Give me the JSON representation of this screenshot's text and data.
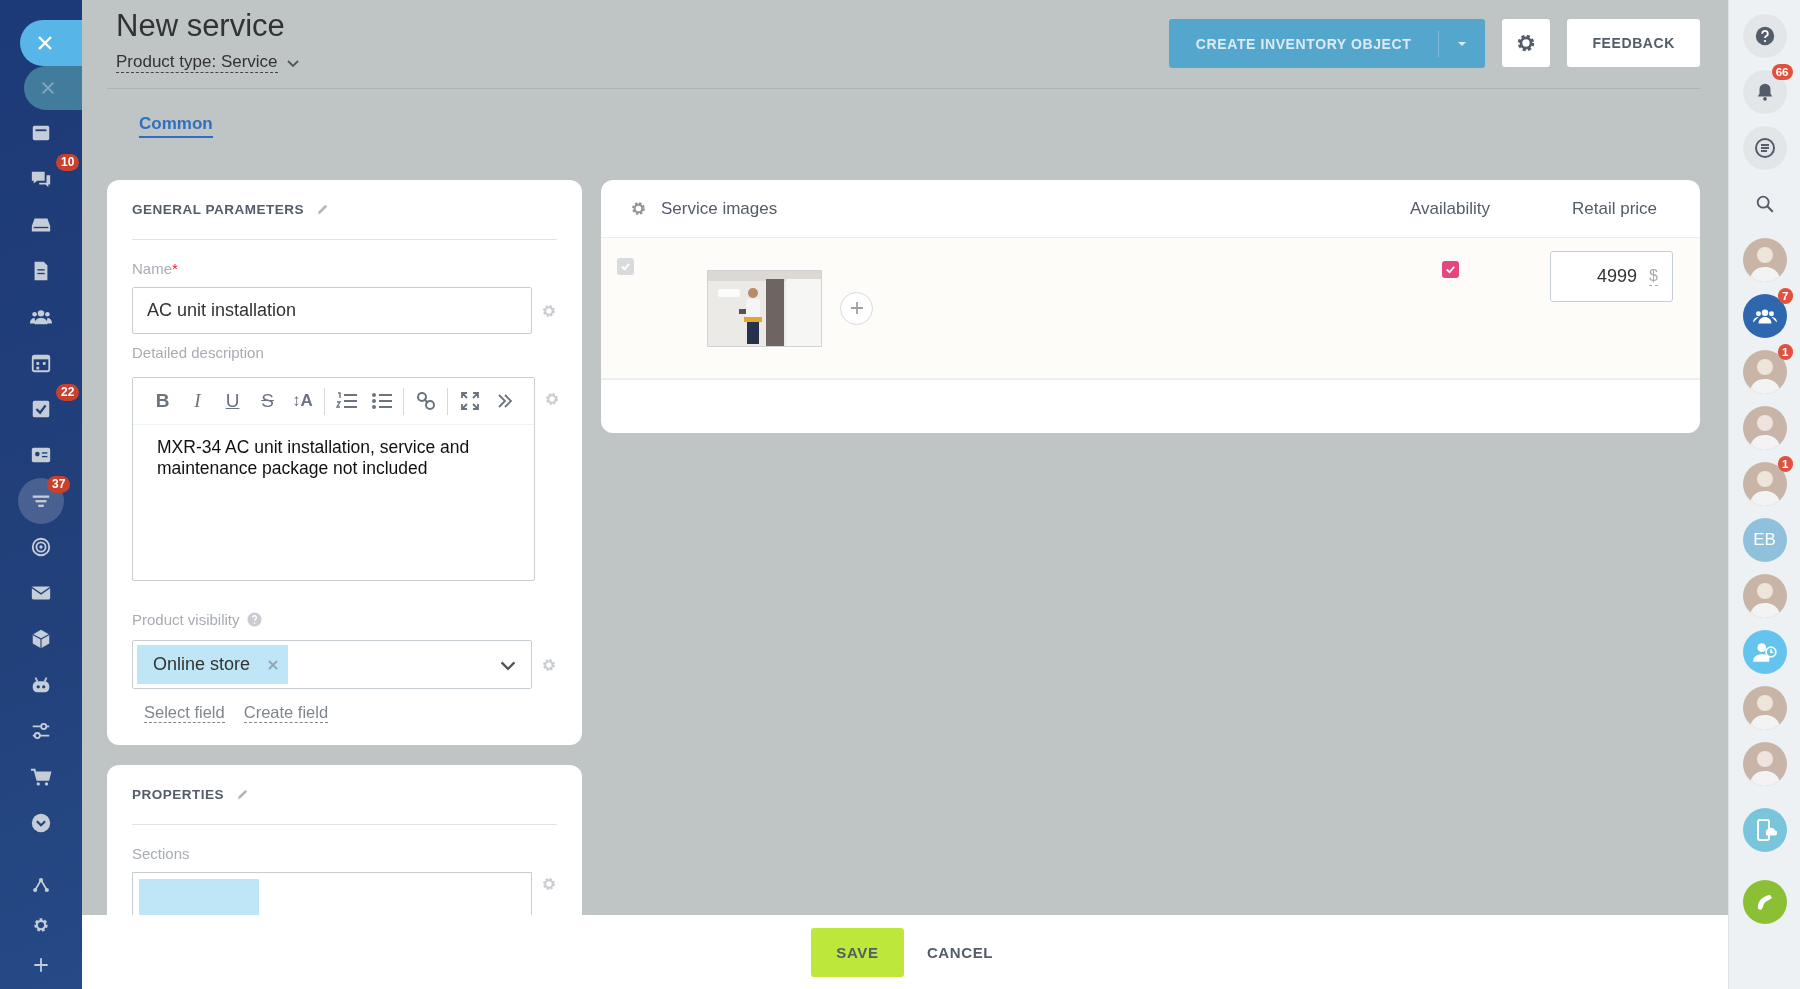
{
  "left_sidebar": {
    "items": [
      {
        "kind": "window",
        "selected": false
      },
      {
        "kind": "chat",
        "badge": "10",
        "selected": false
      },
      {
        "kind": "drive",
        "selected": false
      },
      {
        "kind": "document",
        "selected": false
      },
      {
        "kind": "group",
        "selected": false
      },
      {
        "kind": "calendar",
        "selected": false
      },
      {
        "kind": "task",
        "badge": "22",
        "selected": false
      },
      {
        "kind": "contact",
        "selected": false
      },
      {
        "kind": "filter",
        "badge": "37",
        "selected": true
      },
      {
        "kind": "target",
        "selected": false
      },
      {
        "kind": "mail",
        "selected": false
      },
      {
        "kind": "box",
        "selected": false
      },
      {
        "kind": "robot",
        "selected": false
      },
      {
        "kind": "sliders",
        "selected": false
      },
      {
        "kind": "cart",
        "selected": false
      },
      {
        "kind": "more",
        "selected": false
      }
    ],
    "bottom": [
      {
        "kind": "nodes"
      },
      {
        "kind": "gear"
      },
      {
        "kind": "plus"
      }
    ]
  },
  "header": {
    "title": "New service",
    "product_type": "Product type: Service",
    "create_button": "CREATE INVENTORY OBJECT",
    "feedback_button": "FEEDBACK"
  },
  "tabs": [
    {
      "label": "Common",
      "selected": true
    }
  ],
  "general_parameters": {
    "title": "GENERAL PARAMETERS",
    "name_label": "Name",
    "required_mark": "*",
    "name_value": "AC unit installation",
    "description_label": "Detailed description",
    "toolbar": [
      {
        "kind": "bold",
        "label": "B"
      },
      {
        "kind": "italic",
        "label": "I"
      },
      {
        "kind": "underline",
        "label": "U"
      },
      {
        "kind": "strike",
        "label": "S"
      },
      {
        "kind": "size",
        "label": "↕A"
      },
      {
        "kind": "sep"
      },
      {
        "kind": "ordered-list"
      },
      {
        "kind": "bullet-list"
      },
      {
        "kind": "sep"
      },
      {
        "kind": "link"
      },
      {
        "kind": "sep"
      },
      {
        "kind": "expand"
      },
      {
        "kind": "more"
      }
    ],
    "description": "MXR-34 AC unit installation, service and maintenance package not included",
    "visibility_label": "Product visibility",
    "visibility_tags": [
      "Online store"
    ],
    "select_field": "Select field",
    "create_field": "Create field"
  },
  "properties": {
    "title": "PROPERTIES",
    "sections_label": "Sections"
  },
  "variants_table": {
    "columns": [
      "Service images",
      "Availability",
      "Retail price"
    ],
    "rows": [
      {
        "checked": true,
        "disabled": true,
        "available": true,
        "price": "4999",
        "currency": "$"
      }
    ]
  },
  "right_sidebar": [
    {
      "kind": "help"
    },
    {
      "kind": "bell",
      "badge": "66"
    },
    {
      "kind": "chat-list"
    },
    {
      "kind": "search"
    },
    {
      "kind": "avatar"
    },
    {
      "kind": "group-chat",
      "badge": "7"
    },
    {
      "kind": "avatar",
      "badge": "1"
    },
    {
      "kind": "avatar"
    },
    {
      "kind": "avatar",
      "badge": "1"
    },
    {
      "kind": "initials",
      "label": "EB"
    },
    {
      "kind": "avatar"
    },
    {
      "kind": "user-clock"
    },
    {
      "kind": "avatar"
    },
    {
      "kind": "avatar"
    },
    {
      "kind": "phone-cloud"
    },
    {
      "kind": "call"
    }
  ],
  "footer": {
    "save": "SAVE",
    "cancel": "CANCEL"
  }
}
